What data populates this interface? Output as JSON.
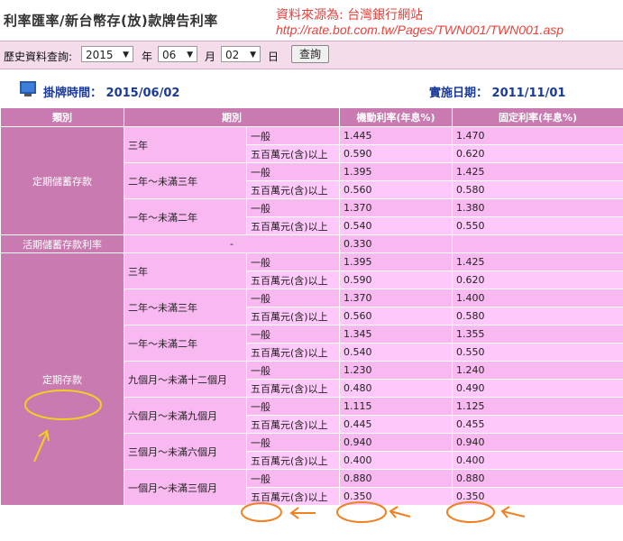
{
  "header": {
    "title": "利率匯率/新台幣存(放)款牌告利率",
    "source_line1": "資料來源為: 台灣銀行網站",
    "source_line2": "http://rate.bot.com.tw/Pages/TWN001/TWN001.asp"
  },
  "query": {
    "label": "歷史資料查詢:",
    "year_value": "2015",
    "year_unit": "年",
    "month_value": "06",
    "month_unit": "月",
    "day_value": "02",
    "day_unit": "日",
    "submit_label": "查詢"
  },
  "info": {
    "posted_label": "掛牌時間：",
    "posted_value": "2015/06/02",
    "effective_label": "實施日期：",
    "effective_value": "2011/11/01"
  },
  "table": {
    "headers": [
      "類別",
      "期別",
      "機動利率(年息%)",
      "固定利率(年息%)"
    ],
    "savings_category": "定期儲蓄存款",
    "savings_terms": [
      {
        "term": "三年",
        "general": "一般",
        "large": "五百萬元(含)以上",
        "float_general": "1.445",
        "fixed_general": "1.470",
        "float_large": "0.590",
        "fixed_large": "0.620"
      },
      {
        "term": "二年～未滿三年",
        "general": "一般",
        "large": "五百萬元(含)以上",
        "float_general": "1.395",
        "fixed_general": "1.425",
        "float_large": "0.560",
        "fixed_large": "0.580"
      },
      {
        "term": "一年～未滿二年",
        "general": "一般",
        "large": "五百萬元(含)以上",
        "float_general": "1.370",
        "fixed_general": "1.380",
        "float_large": "0.540",
        "fixed_large": "0.550"
      }
    ],
    "demand_category": "活期儲蓄存款利率",
    "demand_term": "-",
    "demand_rate": "0.330",
    "time_category": "定期存款",
    "time_terms": [
      {
        "term": "三年",
        "general": "一般",
        "large": "五百萬元(含)以上",
        "float_general": "1.395",
        "fixed_general": "1.425",
        "float_large": "0.590",
        "fixed_large": "0.620"
      },
      {
        "term": "二年～未滿三年",
        "general": "一般",
        "large": "五百萬元(含)以上",
        "float_general": "1.370",
        "fixed_general": "1.400",
        "float_large": "0.560",
        "fixed_large": "0.580"
      },
      {
        "term": "一年～未滿二年",
        "general": "一般",
        "large": "五百萬元(含)以上",
        "float_general": "1.345",
        "fixed_general": "1.355",
        "float_large": "0.540",
        "fixed_large": "0.550"
      },
      {
        "term": "九個月～未滿十二個月",
        "general": "一般",
        "large": "五百萬元(含)以上",
        "float_general": "1.230",
        "fixed_general": "1.240",
        "float_large": "0.480",
        "fixed_large": "0.490"
      },
      {
        "term": "六個月～未滿九個月",
        "general": "一般",
        "large": "五百萬元(含)以上",
        "float_general": "1.115",
        "fixed_general": "1.125",
        "float_large": "0.445",
        "fixed_large": "0.455"
      },
      {
        "term": "三個月～未滿六個月",
        "general": "一般",
        "large": "五百萬元(含)以上",
        "float_general": "0.940",
        "fixed_general": "0.940",
        "float_large": "0.400",
        "fixed_large": "0.400"
      },
      {
        "term": "一個月～未滿三個月",
        "general": "一般",
        "large": "五百萬元(含)以上",
        "float_general": "0.880",
        "fixed_general": "0.880",
        "float_large": "0.350",
        "fixed_large": "0.350"
      }
    ]
  },
  "colors": {
    "header_pink": "#c97ab0",
    "cell_pink": "#f8b8f0",
    "annotation_orange": "#f08020",
    "annotation_yellow": "#f0d020",
    "source_red": "#e8403a"
  }
}
